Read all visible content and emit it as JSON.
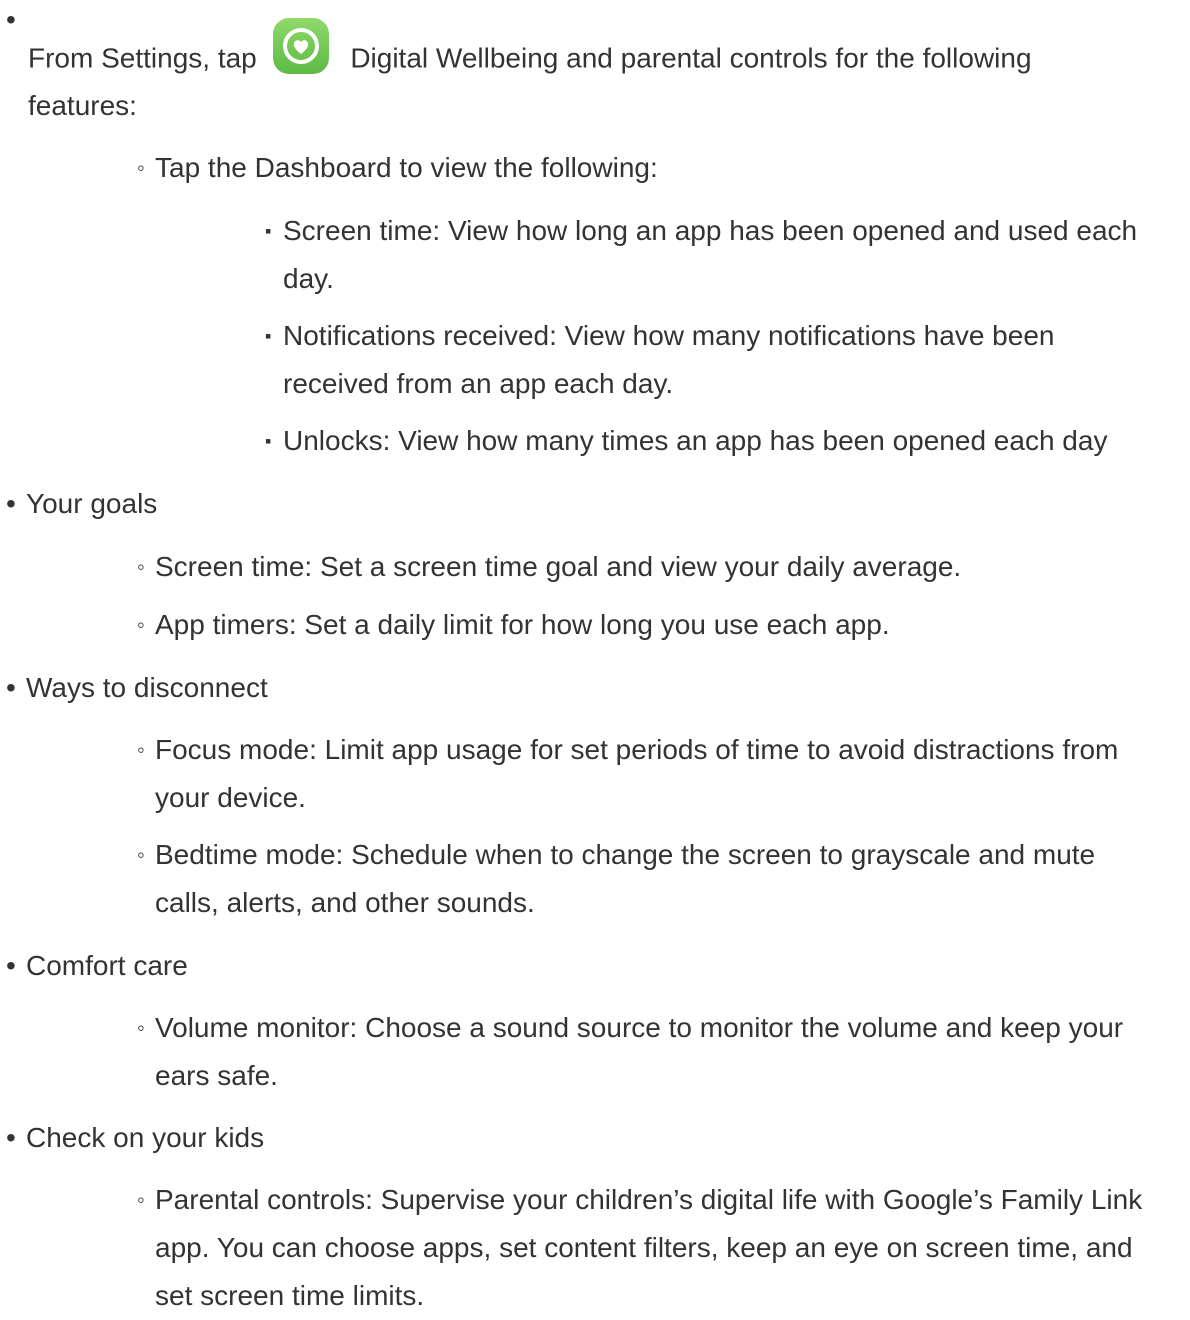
{
  "intro": {
    "text_before_icon": "From Settings, tap ",
    "icon": "digital-wellbeing-icon",
    "text_after_icon": " Digital Wellbeing and parental controls for the following",
    "text_line2": "features:"
  },
  "markers": {
    "bullet": "•",
    "circle": "◦",
    "square": "▪"
  },
  "dashboard": {
    "label": "Tap the Dashboard to view the following:",
    "items": [
      "Screen time: View how long an app has been opened and used each day.",
      "Notifications received: View how many notifications have been received from an app each day.",
      "Unlocks: View how many times an app has been opened each day"
    ]
  },
  "goals": {
    "label": "Your goals",
    "items": [
      "Screen time: Set a screen time goal and view your daily average.",
      "App timers: Set a daily limit for how long you use each app."
    ]
  },
  "disconnect": {
    "label": "Ways to disconnect",
    "items": [
      "Focus mode: Limit app usage for set periods of time to avoid distractions from your device.",
      "Bedtime mode: Schedule when to change the screen to grayscale and mute calls, alerts, and other sounds."
    ]
  },
  "comfort": {
    "label": "Comfort care",
    "items": [
      "Volume monitor: Choose a sound source to monitor the volume and keep your ears safe."
    ]
  },
  "kids": {
    "label": "Check on your kids",
    "items": [
      "Parental controls: Supervise your children’s digital life with Google’s Family Link app. You can choose apps, set content filters, keep an eye on screen time, and set screen time limits."
    ]
  },
  "colors": {
    "text": "#333333",
    "icon_green": "#6cc24a"
  }
}
